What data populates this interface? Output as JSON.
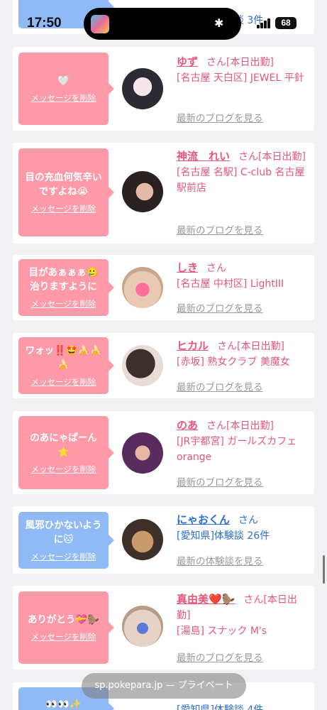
{
  "status": {
    "time": "17:50",
    "battery": "68"
  },
  "top_partial": {
    "info": "[愛知県]体験談 3件",
    "msg": ""
  },
  "common": {
    "delete_label": "メッセージを削除",
    "san": "さん",
    "blog_link": "最新のブログを見る",
    "review_link": "最新の体験談を見る"
  },
  "messages": [
    {
      "message": "🤍",
      "name": "ゆず",
      "today": "[本日出勤]",
      "shop": "[名古屋 天白区] JEWEL 平針",
      "color": "pink"
    },
    {
      "message": "目の充血何気辛いですよね😭",
      "name": "神流　れい",
      "today": "[本日出勤]",
      "shop": "[名古屋 名駅] C-club 名古屋駅前店",
      "color": "pink"
    },
    {
      "message": "目があぁぁぁ🥲治りますように",
      "name": "しき",
      "today": "",
      "shop": "[名古屋 中村区] LightIII",
      "color": "pink"
    },
    {
      "message": "ワォッ‼️🤩🍌🍌🍌",
      "name": "ヒカル",
      "today": "[本日出勤]",
      "shop": "[赤坂] 熟女クラブ 美魔女",
      "color": "pink"
    },
    {
      "message": "のあにゃぱーん⭐",
      "name": "のあ",
      "today": "[本日出勤]",
      "shop": "[JR宇都宮] ガールズカフェorange",
      "color": "pink"
    },
    {
      "message": "風邪ひかないように🐱",
      "name": "にゃおくん",
      "today": "",
      "shop": "[愛知県]体験談 26件",
      "color": "blue"
    },
    {
      "message": "ありがとう💝🦫",
      "name": "真由美❤️🦫",
      "today": "[本日出勤]",
      "shop": "[湯島] スナック M's",
      "color": "pink"
    }
  ],
  "bottom_partial": {
    "message": "👀👀✨",
    "info": "[愛知県]体験談 4件"
  },
  "url_bar": {
    "text": "sp.pokepara.jp — プライベート"
  }
}
